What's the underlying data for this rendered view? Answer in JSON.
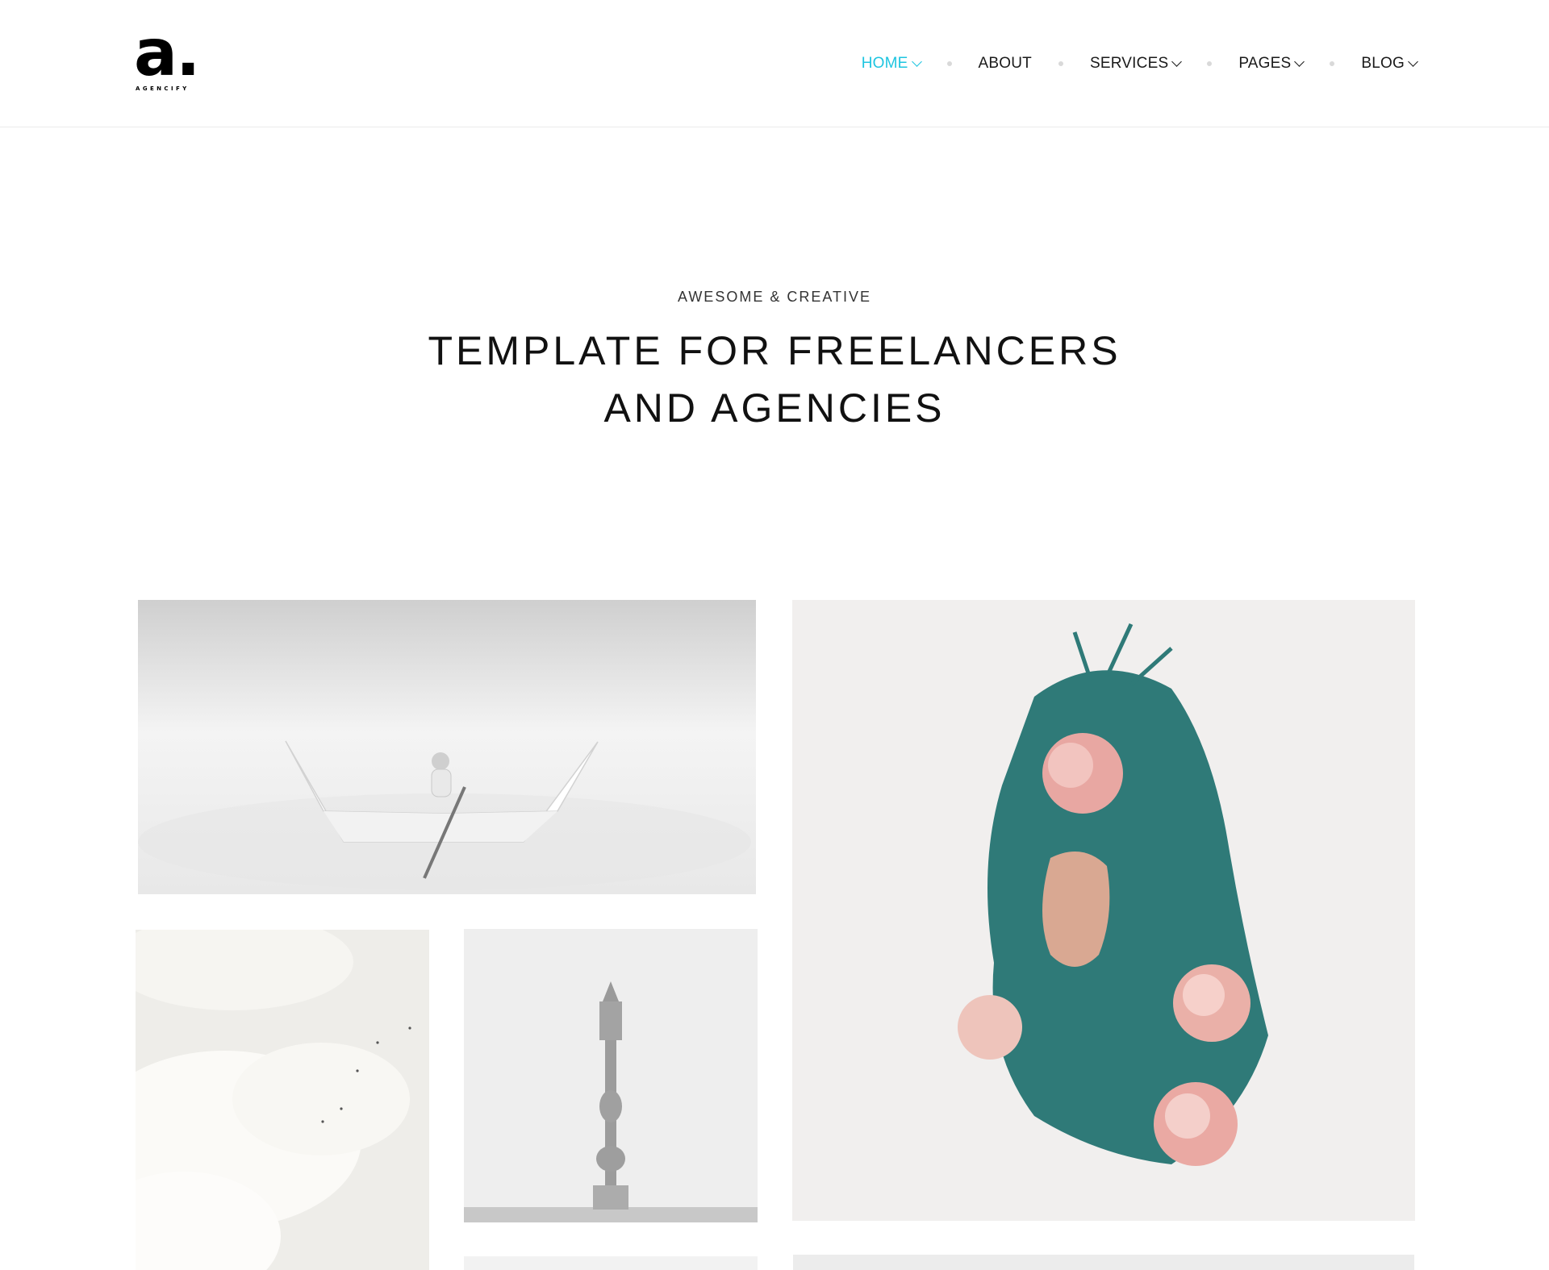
{
  "brand": {
    "logo_mark": "a.",
    "logo_sub": "AGENCIFY"
  },
  "nav": {
    "items": [
      {
        "label": "HOME",
        "has_dropdown": true,
        "active": true
      },
      {
        "label": "ABOUT",
        "has_dropdown": false,
        "active": false
      },
      {
        "label": "SERVICES",
        "has_dropdown": true,
        "active": false
      },
      {
        "label": "PAGES",
        "has_dropdown": true,
        "active": false
      },
      {
        "label": "BLOG",
        "has_dropdown": true,
        "active": false
      }
    ],
    "active_color": "#1ec5e0",
    "separator_color": "#d9d9d9"
  },
  "hero": {
    "kicker": "AWESOME & CREATIVE",
    "title_line1": "TEMPLATE FOR FREELANCERS",
    "title_line2": "AND AGENCIES"
  },
  "portfolio": {
    "tiles": [
      {
        "name": "paper-boat-image"
      },
      {
        "name": "floral-portrait-image"
      },
      {
        "name": "clouds-image"
      },
      {
        "name": "lamp-tower-image"
      }
    ]
  }
}
